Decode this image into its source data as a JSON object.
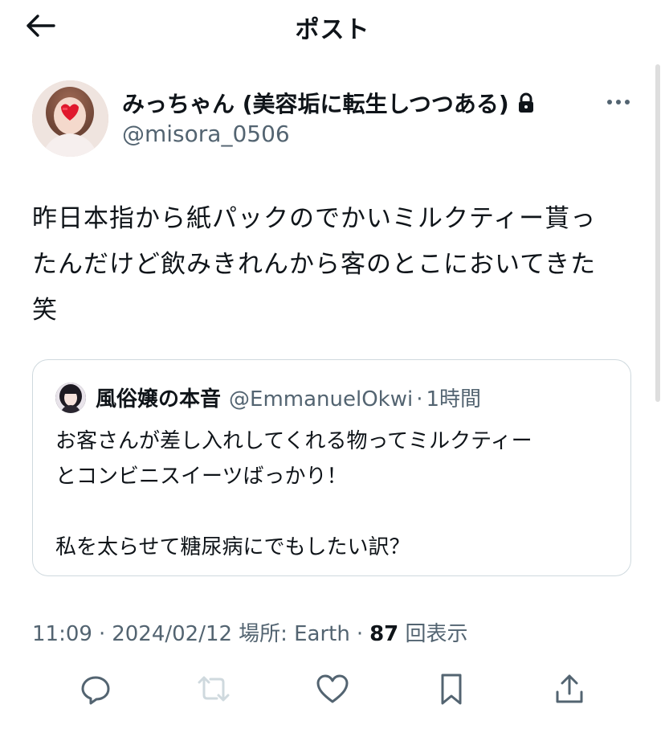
{
  "header": {
    "title": "ポスト"
  },
  "author": {
    "display_name": "みっちゃん (美容垢に転生しつつある)",
    "handle": "@misora_0506"
  },
  "post": {
    "lines": [
      "昨日本指から紙パックのでかいミルクティー貰っ",
      "たんだけど飲みきれんから客のとこにおいてきた",
      "笑"
    ]
  },
  "quote": {
    "name": "風俗嬢の本音",
    "handle": "@EmmanuelOkwi",
    "separator": "·",
    "time": "1時間",
    "lines": [
      "お客さんが差し入れしてくれる物ってミルクティー",
      "とコンビニスイーツばっかり！",
      "",
      "私を太らせて糖尿病にでもしたい訳？"
    ]
  },
  "meta": {
    "time": "11:09",
    "dot1": "·",
    "date": "2024/02/12",
    "location": "場所: Earth",
    "dot2": "·",
    "views_count": "87",
    "views_label": "回表示"
  },
  "icons": {
    "back": "arrow-left-icon",
    "lock": "lock-icon",
    "more": "more-horizontal-icon",
    "reply": "reply-icon",
    "repost": "repost-icon",
    "like": "heart-icon",
    "bookmark": "bookmark-icon",
    "share": "share-icon"
  },
  "colors": {
    "text": "#0f1419",
    "secondary": "#536471",
    "border": "#cfd9de",
    "repost_disabled": "#cfd9de"
  }
}
